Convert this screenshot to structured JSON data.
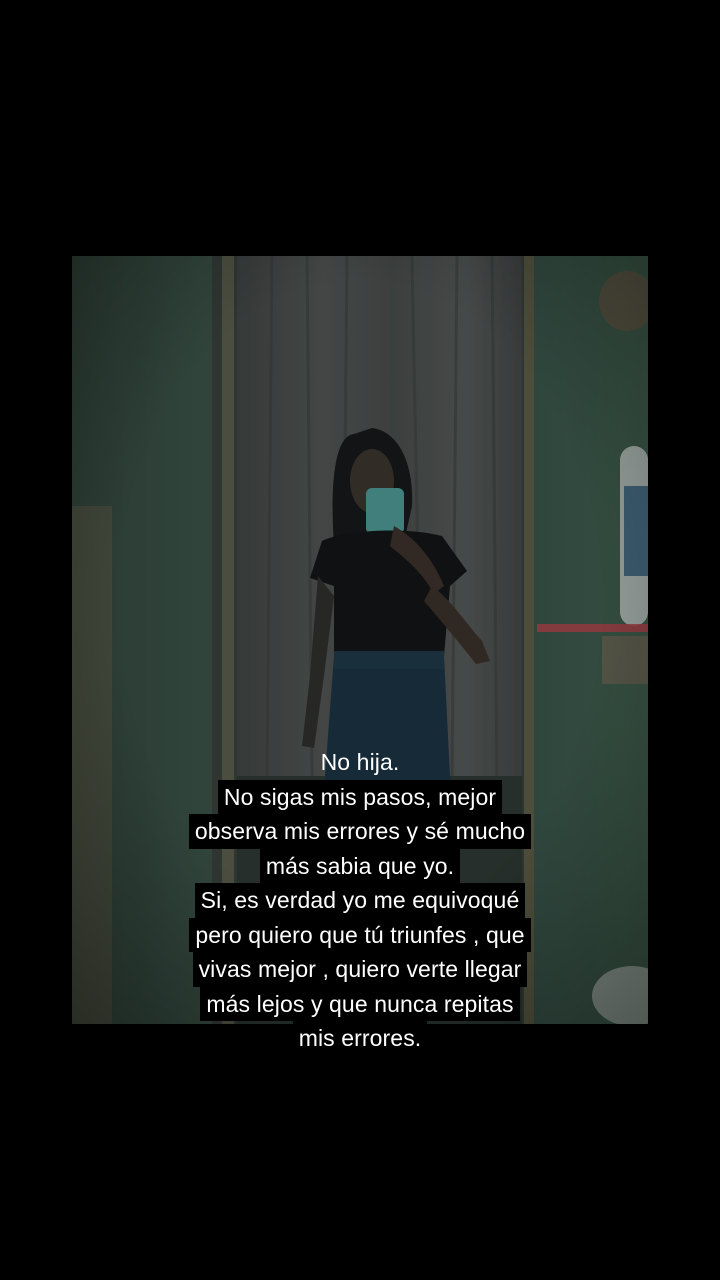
{
  "caption": {
    "lines": [
      "No hija.",
      "No sigas mis pasos, mejor",
      "observa mis errores y sé mucho",
      "más sabia que yo.",
      "Si, es verdad yo me equivoqué",
      "pero quiero que tú triunfes , que",
      "vivas mejor , quiero verte llegar",
      "más lejos y que nunca repitas",
      "mis errores."
    ]
  },
  "colors": {
    "background": "#000000",
    "wall": "#3f5a52",
    "curtain": "#4b4e4d",
    "caption_text": "#ffffff",
    "caption_box": "#000000"
  }
}
